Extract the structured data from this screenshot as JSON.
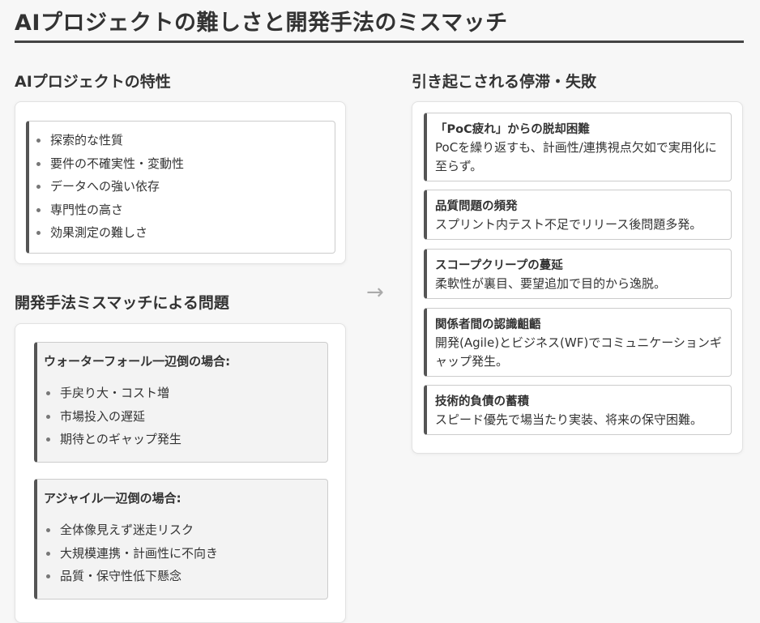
{
  "title": "AIプロジェクトの難しさと開発手法のミスマッチ",
  "characteristics": {
    "heading": "AIプロジェクトの特性",
    "items": [
      "探索的な性質",
      "要件の不確実性・変動性",
      "データへの強い依存",
      "専門性の高さ",
      "効果測定の難しさ"
    ]
  },
  "mismatch": {
    "heading": "開発手法ミスマッチによる問題",
    "waterfall": {
      "title": "ウォーターフォール一辺倒の場合:",
      "items": [
        "手戻り大・コスト増",
        "市場投入の遅延",
        "期待とのギャップ発生"
      ]
    },
    "agile": {
      "title": "アジャイル一辺倒の場合:",
      "items": [
        "全体像見えず迷走リスク",
        "大規模連携・計画性に不向き",
        "品質・保守性低下懸念"
      ]
    }
  },
  "arrow": "→",
  "failures": {
    "heading": "引き起こされる停滞・失敗",
    "items": [
      {
        "title": "「PoC疲れ」からの脱却困難",
        "desc": "PoCを繰り返すも、計画性/連携視点欠如で実用化に至らず。"
      },
      {
        "title": "品質問題の頻発",
        "desc": "スプリント内テスト不足でリリース後問題多発。"
      },
      {
        "title": "スコープクリープの蔓延",
        "desc": "柔軟性が裏目、要望追加で目的から逸脱。"
      },
      {
        "title": "関係者間の認識齟齬",
        "desc": "開発(Agile)とビジネス(WF)でコミュニケーションギャップ発生。"
      },
      {
        "title": "技術的負債の蓄積",
        "desc": "スピード優先で場当たり実装、将来の保守困難。"
      }
    ]
  }
}
